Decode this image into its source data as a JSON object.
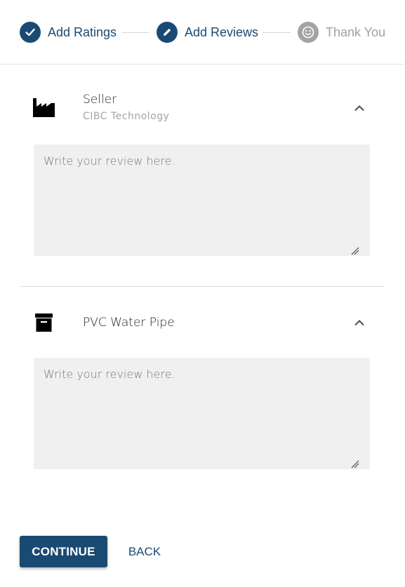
{
  "stepper": {
    "steps": [
      {
        "label": "Add Ratings",
        "state": "completed",
        "icon": "check-icon"
      },
      {
        "label": "Add Reviews",
        "state": "active",
        "icon": "pencil-icon"
      },
      {
        "label": "Thank You",
        "state": "inactive",
        "icon": "smiley-icon"
      }
    ]
  },
  "sections": [
    {
      "icon": "factory-icon",
      "title": "Seller",
      "subtitle": "CIBC Technology",
      "review_placeholder": "Write your review here.",
      "review_value": ""
    },
    {
      "icon": "archive-box-icon",
      "title": "PVC Water Pipe",
      "review_placeholder": "Write your review here.",
      "review_value": ""
    }
  ],
  "footer": {
    "continue_label": "CONTINUE",
    "back_label": "BACK"
  },
  "colors": {
    "primary": "#1a4a73",
    "inactive": "#a3a3a3",
    "textarea_bg": "#f0f0f0"
  }
}
